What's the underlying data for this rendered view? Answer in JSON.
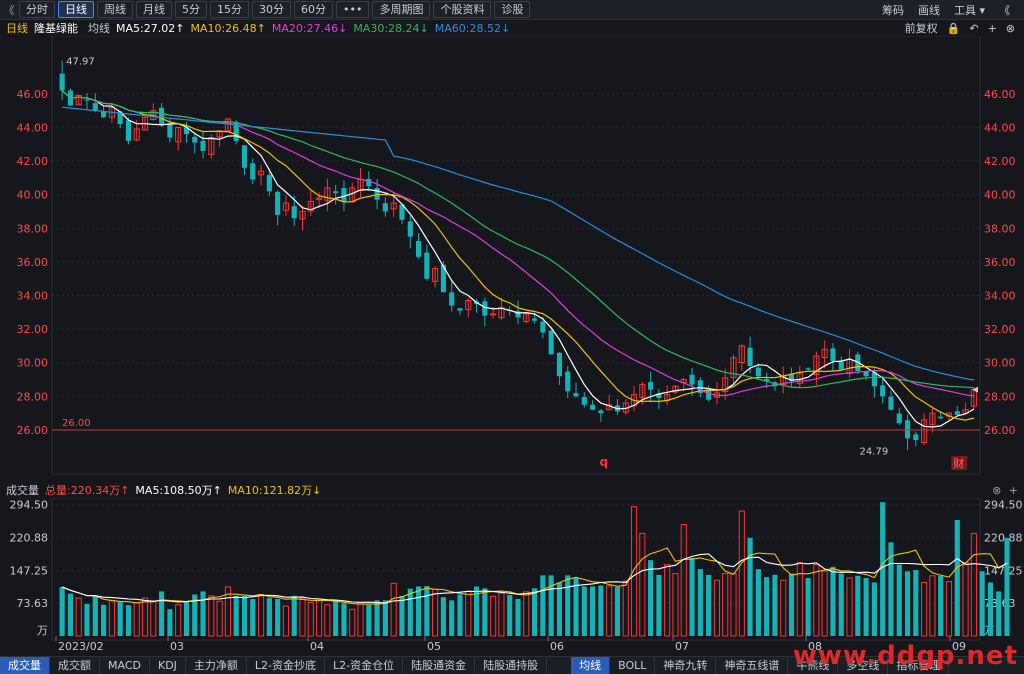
{
  "toolbar": {
    "back": "《",
    "items": [
      "分时",
      "日线",
      "周线",
      "月线",
      "5分",
      "15分",
      "30分",
      "60分",
      "•••",
      "多周期图",
      "个股资料",
      "诊股"
    ],
    "active_index": 1,
    "right": [
      "筹码",
      "画线",
      "工具 ▾",
      "《"
    ]
  },
  "ma_bar": {
    "period": "日线",
    "stock": "隆基绿能",
    "type": "均线",
    "ma5": "MA5:27.02↑",
    "ma10": "MA10:26.48↑",
    "ma20": "MA20:27.46↓",
    "ma30": "MA30:28.24↓",
    "ma60": "MA60:28.52↓",
    "right": [
      "前复权",
      "🔒",
      "↶",
      "+",
      "⊗"
    ]
  },
  "price_axis": {
    "ticks": [
      "46.00",
      "44.00",
      "42.00",
      "40.00",
      "38.00",
      "36.00",
      "34.00",
      "32.00",
      "30.00",
      "28.00",
      "26.00"
    ],
    "high_label": "47.97",
    "low_label": "24.79",
    "level_label": "26.00",
    "marker_q": "q",
    "marker_cai": "财"
  },
  "volume_bar": {
    "name": "成交量",
    "total": "总量:220.34万↑",
    "ma5": "MA5:108.50万↑",
    "ma10": "MA10:121.82万↓",
    "ticks": [
      "294.50",
      "220.88",
      "147.25",
      "73.63",
      "万"
    ]
  },
  "x_axis": [
    "2023/02",
    "03",
    "04",
    "05",
    "06",
    "07",
    "08",
    "09"
  ],
  "bottom_tabs": [
    "成交量",
    "成交额",
    "MACD",
    "KDJ",
    "主力净额",
    "L2-资金抄底",
    "L2-资金仓位",
    "陆股通资金",
    "陆股通持股",
    "均线",
    "BOLL",
    "神奇九转",
    "神奇五线谱",
    "牛熊线",
    "多空线",
    "指标管理"
  ],
  "watermark": "www.ddgp.net",
  "colors": {
    "up": "#ff3232",
    "down": "#14b3b8",
    "ma5": "#ffffff",
    "ma10": "#f2c200",
    "ma20": "#e040d8",
    "ma30": "#2fb95c",
    "ma60": "#2a8fe0"
  },
  "chart_data": {
    "type": "candlestick",
    "price_min": 24.79,
    "price_max": 47.97,
    "ylim": [
      23.5,
      49.2
    ],
    "support_line": 26.0,
    "candles": [],
    "close": [
      46.2,
      45.3,
      45.9,
      45.6,
      45.0,
      44.6,
      45.2,
      44.2,
      43.2,
      43.9,
      44.6,
      45.0,
      44.1,
      43.4,
      44.0,
      43.6,
      43.1,
      42.6,
      43.4,
      43.8,
      44.5,
      43.2,
      41.6,
      40.9,
      41.4,
      40.2,
      38.8,
      39.5,
      38.6,
      39.0,
      39.6,
      39.8,
      40.4,
      40.1,
      39.6,
      40.4,
      40.9,
      40.5,
      39.7,
      39.0,
      39.5,
      38.5,
      37.5,
      36.3,
      35.0,
      35.6,
      34.2,
      33.4,
      33.1,
      33.7,
      33.5,
      32.8,
      32.9,
      33.3,
      33.1,
      32.7,
      32.9,
      32.5,
      31.8,
      30.5,
      29.2,
      28.3,
      28.0,
      27.5,
      27.2,
      27.0,
      27.5,
      27.1,
      27.6,
      28.1,
      28.7,
      28.4,
      27.9,
      28.1,
      28.6,
      29.0,
      28.7,
      28.2,
      27.8,
      28.2,
      29.1,
      30.3,
      31.0,
      29.8,
      29.2,
      28.9,
      28.6,
      29.2,
      28.9,
      29.4,
      29.6,
      30.4,
      30.8,
      30.1,
      29.6,
      30.2,
      29.5,
      29.2,
      28.6,
      28.0,
      27.2,
      26.4,
      25.5,
      25.4,
      26.6,
      27.0,
      26.7,
      27.0,
      26.9,
      27.2,
      28.4
    ],
    "volume_high": 294.5,
    "volume_ticks": [
      294.5,
      220.88,
      147.25,
      73.63
    ],
    "volume": [
      110,
      95,
      85,
      72,
      90,
      70,
      80,
      76,
      69,
      75,
      85,
      78,
      100,
      60,
      70,
      78,
      93,
      100,
      90,
      78,
      110,
      90,
      90,
      83,
      93,
      85,
      83,
      67,
      90,
      85,
      75,
      80,
      70,
      80,
      73,
      60,
      75,
      70,
      80,
      80,
      118,
      90,
      106,
      111,
      112,
      105,
      87,
      80,
      93,
      100,
      111,
      107,
      89,
      96,
      92,
      83,
      99,
      107,
      136,
      136,
      120,
      136,
      130,
      111,
      111,
      113,
      112,
      110,
      123,
      290,
      230,
      170,
      137,
      160,
      140,
      250,
      175,
      150,
      137,
      125,
      140,
      140,
      280,
      220,
      150,
      132,
      137,
      125,
      140,
      165,
      130,
      160,
      145,
      155,
      140,
      130,
      135,
      130,
      120,
      300,
      210,
      160,
      145,
      148,
      120,
      135,
      135,
      122,
      260,
      165,
      230,
      145,
      120,
      100,
      220
    ],
    "ma5": [
      27.0,
      27.1,
      27.0
    ],
    "ma10": [
      26.4,
      26.5,
      26.5
    ]
  }
}
